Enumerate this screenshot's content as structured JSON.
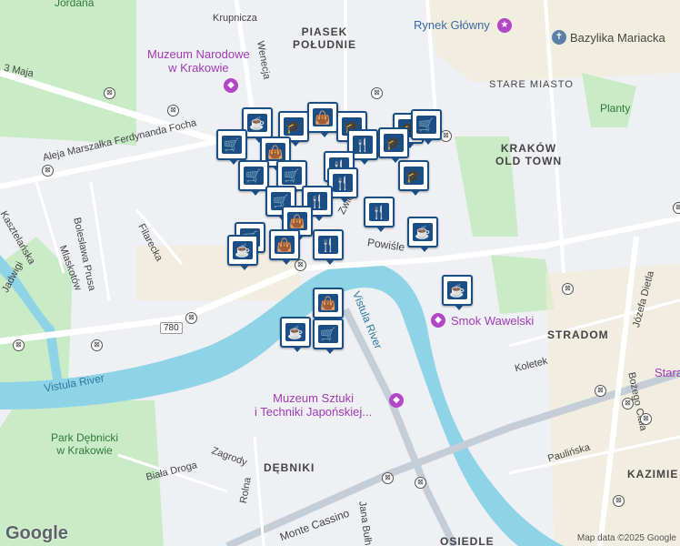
{
  "map": {
    "districts": [
      {
        "id": "piasek",
        "text": "PIASEK\nPOŁUDNIE"
      },
      {
        "id": "stare-miasto",
        "text": "STARE MIASTO"
      },
      {
        "id": "krakow-old-town",
        "text": "KRAKÓW\nOLD TOWN"
      },
      {
        "id": "stradom",
        "text": "STRADOM"
      },
      {
        "id": "debniki",
        "text": "DĘBNIKI"
      },
      {
        "id": "kazimierz",
        "text": "KAZIMIE"
      },
      {
        "id": "osiedle",
        "text": "OSIEDLE"
      }
    ],
    "pois": [
      {
        "id": "muzeum-narodowe",
        "text": "Muzeum Narodowe\nw Krakowie",
        "color": "#a23ab6"
      },
      {
        "id": "rynek",
        "text": "Rynek Główny",
        "color": "#3a6aa8"
      },
      {
        "id": "bazylika",
        "text": "Bazylika Mariacka",
        "color": "#444"
      },
      {
        "id": "smok",
        "text": "Smok Wawelski",
        "color": "#a23ab6"
      },
      {
        "id": "manggha",
        "text": "Muzeum Sztuki\ni Techniki Japońskiej...",
        "color": "#a23ab6"
      },
      {
        "id": "starа",
        "text": "Stara",
        "color": "#a23ab6"
      }
    ],
    "parks": [
      {
        "id": "jordana",
        "text": "Jordana"
      },
      {
        "id": "planty",
        "text": "Planty"
      },
      {
        "id": "park-debnicki",
        "text": "Park Dębnicki\nw Krakowie"
      }
    ],
    "rivers": [
      {
        "id": "vistula-left",
        "text": "Vistula River"
      },
      {
        "id": "vistula-right",
        "text": "Vistula River"
      }
    ],
    "streets": [
      {
        "id": "krupnicza",
        "text": "Krupnicza"
      },
      {
        "id": "wenecja",
        "text": "Wenecja"
      },
      {
        "id": "3maja",
        "text": "3 Maja"
      },
      {
        "id": "foch",
        "text": "Aleja Marszałka Ferdynanda Focha"
      },
      {
        "id": "kasztelanska",
        "text": "Kasztelańska"
      },
      {
        "id": "boleslawa",
        "text": "Bolesława Prusa"
      },
      {
        "id": "mlaskotow",
        "text": "Mlaskotów"
      },
      {
        "id": "filarecka",
        "text": "Filarecka"
      },
      {
        "id": "jadwigi",
        "text": "Jadwigi"
      },
      {
        "id": "powisle",
        "text": "Powiśle"
      },
      {
        "id": "koletek",
        "text": "Koletek"
      },
      {
        "id": "dietla",
        "text": "Józefa Dietla"
      },
      {
        "id": "bozego",
        "text": "Bożego Ciała"
      },
      {
        "id": "paulinska",
        "text": "Paulińska"
      },
      {
        "id": "biala-droga",
        "text": "Biała Droga"
      },
      {
        "id": "zagrody",
        "text": "Zagrody"
      },
      {
        "id": "rolna",
        "text": "Rolna"
      },
      {
        "id": "monte-cassino",
        "text": "Monte Cassino"
      },
      {
        "id": "jana-bulh",
        "text": "Jana Bułh"
      },
      {
        "id": "zwierz",
        "text": "Zwierz"
      }
    ],
    "route_badge": "780",
    "google_logo": "Google",
    "credit": "Map data ©2025 Google",
    "colors": {
      "water": "#8fd3e6",
      "park": "#c9ebc6",
      "marker_border": "#1c4e86",
      "poi": "#a23ab6"
    },
    "marker_icons": [
      "cafe-icon",
      "education-icon",
      "shopping-bag-icon",
      "education-icon",
      "education-icon",
      "shopping-cart-icon",
      "shopping-cart-icon",
      "shopping-bag-icon",
      "restaurant-icon",
      "education-icon",
      "education-icon",
      "shopping-cart-icon",
      "shopping-cart-icon",
      "restaurant-icon",
      "restaurant-icon",
      "shopping-cart-icon",
      "restaurant-icon",
      "shopping-bag-icon",
      "cafe-icon",
      "shopping-cart-icon",
      "shopping-bag-icon",
      "restaurant-icon",
      "cafe-icon",
      "restaurant-icon",
      "cafe-icon",
      "cafe-icon",
      "shopping-bag-icon",
      "shopping-cart-icon"
    ]
  }
}
